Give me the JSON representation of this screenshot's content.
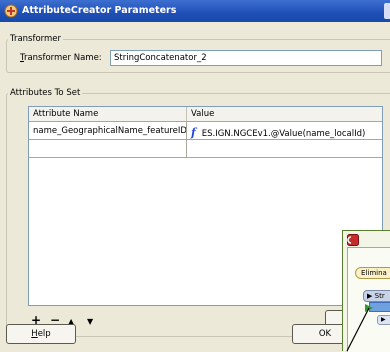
{
  "window": {
    "title": "AttributeCreator Parameters"
  },
  "transformer": {
    "group_label": "Transformer",
    "name_label_mnemonic": "T",
    "name_label_rest": "ransformer Name:",
    "name_value": "StringConcatenator_2"
  },
  "attributes": {
    "group_label": "Attributes To Set",
    "columns": [
      "Attribute Name",
      "Value"
    ],
    "rows": [
      {
        "name": "name_GeographicalName_featureID",
        "value_icon": "function-icon",
        "value_icon_glyph": "f",
        "value": "ES.IGN.NGCEv1.@Value(name_localId)"
      },
      {
        "name": "",
        "value": ""
      }
    ],
    "toolbar": {
      "add": "+",
      "remove": "−",
      "up": "▲",
      "down": "▼"
    }
  },
  "buttons": {
    "help_mnemonic": "H",
    "help_rest": "elp",
    "ok": "OK"
  },
  "background_canvas": {
    "chip_label": "Elimina",
    "node_label": "Str"
  },
  "colors": {
    "titlebar": "#1f4fb6",
    "dialog_bg": "#ece9d8",
    "function_icon": "#2846d8",
    "canvas_bg": "#f3f6e6"
  }
}
